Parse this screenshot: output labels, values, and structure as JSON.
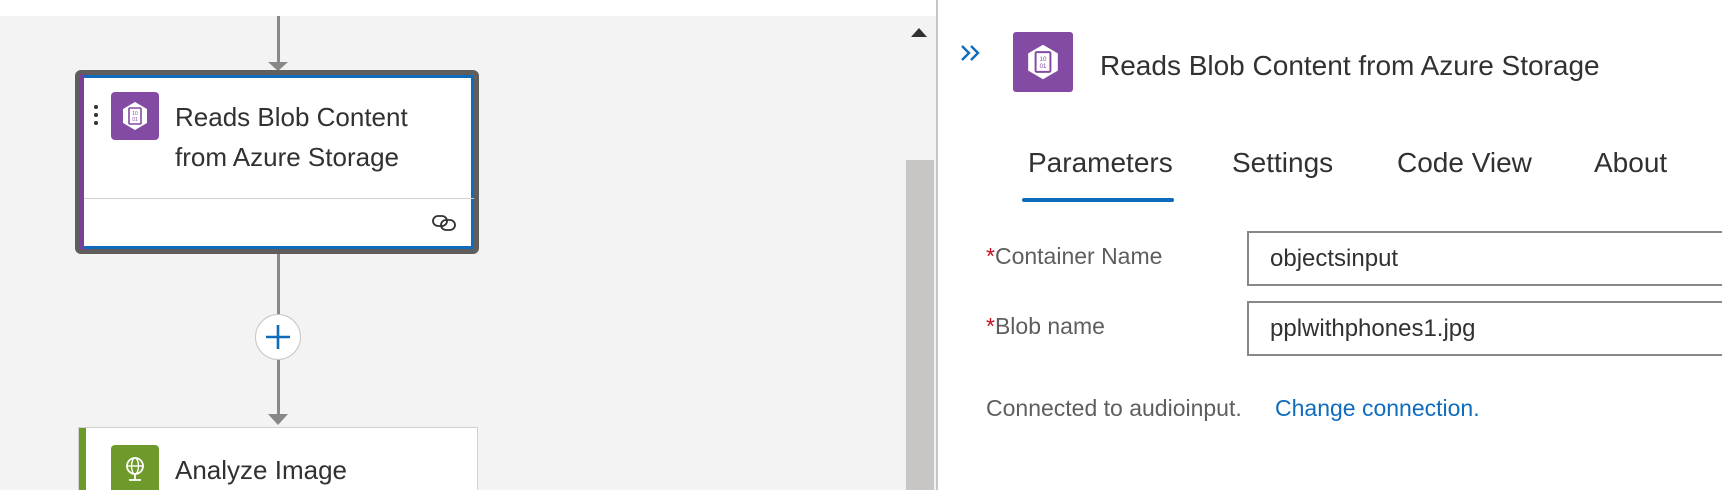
{
  "canvas": {
    "selected_card": {
      "title_line1": "Reads Blob Content",
      "title_line2": "from Azure Storage",
      "icon": "blob-storage-icon",
      "accent_color": "#7b3f99"
    },
    "next_card": {
      "title": "Analyze Image",
      "icon": "computer-vision-icon",
      "accent_color": "#6e9a2b"
    },
    "add_step_icon": "plus-icon"
  },
  "panel": {
    "title": "Reads Blob Content from Azure Storage",
    "tabs": [
      {
        "label": "Parameters",
        "active": true
      },
      {
        "label": "Settings",
        "active": false
      },
      {
        "label": "Code View",
        "active": false
      },
      {
        "label": "About",
        "active": false
      }
    ],
    "fields": [
      {
        "required_mark": "*",
        "label": "Container Name",
        "value": "objectsinput"
      },
      {
        "required_mark": "*",
        "label": "Blob name",
        "value": "pplwithphones1.jpg"
      }
    ],
    "connection_text": "Connected to audioinput.",
    "change_connection_label": "Change connection."
  },
  "colors": {
    "accent_blue": "#0f6cbd",
    "blob_purple": "#834ba3",
    "vision_green": "#6e9a2b",
    "required_red": "#c50f1f"
  }
}
